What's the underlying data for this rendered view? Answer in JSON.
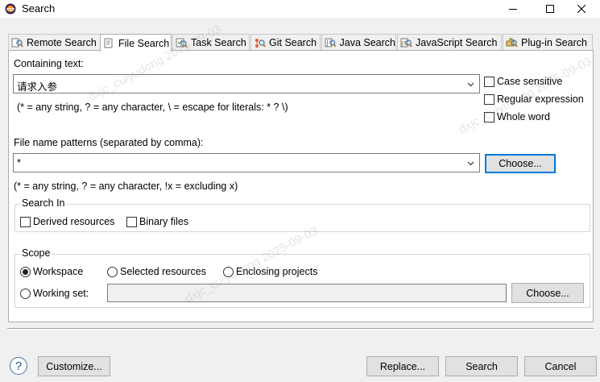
{
  "window": {
    "title": "Search"
  },
  "tabs": [
    {
      "label": "Remote Search",
      "icon": "remote-search-icon"
    },
    {
      "label": "File Search",
      "icon": "file-search-icon"
    },
    {
      "label": "Task Search",
      "icon": "task-search-icon"
    },
    {
      "label": "Git Search",
      "icon": "git-search-icon"
    },
    {
      "label": "Java Search",
      "icon": "java-search-icon"
    },
    {
      "label": "JavaScript Search",
      "icon": "javascript-search-icon"
    },
    {
      "label": "Plug-in Search",
      "icon": "plugin-search-icon"
    }
  ],
  "active_tab": "File Search",
  "containing": {
    "label": "Containing text:",
    "value": "请求入参",
    "hint": "(* = any string, ? = any character, \\ = escape for literals: * ? \\)"
  },
  "options": {
    "case_sensitive": {
      "label": "Case sensitive",
      "checked": false
    },
    "regex": {
      "label": "Regular expression",
      "checked": false
    },
    "whole_word": {
      "label": "Whole word",
      "checked": false
    }
  },
  "patterns": {
    "label": "File name patterns (separated by comma):",
    "value": "*",
    "hint": "(* = any string, ? = any character, !x = excluding x)",
    "choose_label": "Choose..."
  },
  "search_in": {
    "title": "Search In",
    "derived": {
      "label": "Derived resources",
      "checked": false
    },
    "binary": {
      "label": "Binary files",
      "checked": false
    }
  },
  "scope": {
    "title": "Scope",
    "workspace": {
      "label": "Workspace",
      "selected": true
    },
    "selected_resources": {
      "label": "Selected resources",
      "selected": false
    },
    "enclosing_projects": {
      "label": "Enclosing projects",
      "selected": false
    },
    "working_set": {
      "label": "Working set:",
      "selected": false,
      "value": ""
    },
    "choose_label": "Choose..."
  },
  "footer": {
    "help": "?",
    "customize": "Customize...",
    "replace": "Replace...",
    "search": "Search",
    "cancel": "Cancel"
  },
  "watermarks": [
    "dxjc_cuiyudong 2025-09-03",
    "dxjc_cuiyudong 2025-09-03",
    "dxjc_cuiyudong 2025-09-03"
  ],
  "colors": {
    "focus": "#0078d7",
    "panel": "#ffffff",
    "dialog": "#f0f0f0"
  }
}
